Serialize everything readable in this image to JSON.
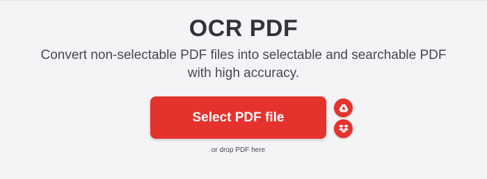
{
  "page": {
    "title": "OCR PDF",
    "subtitle": "Convert non-selectable PDF files into selectable and searchable PDF with high accuracy."
  },
  "upload": {
    "select_label": "Select PDF file",
    "drop_hint": "or drop PDF here",
    "cloud_sources": [
      {
        "icon": "google-drive-icon"
      },
      {
        "icon": "dropbox-icon"
      }
    ]
  },
  "colors": {
    "accent": "#e5322d",
    "background": "#f4f4f6",
    "heading": "#33333b",
    "text": "#47474f"
  }
}
